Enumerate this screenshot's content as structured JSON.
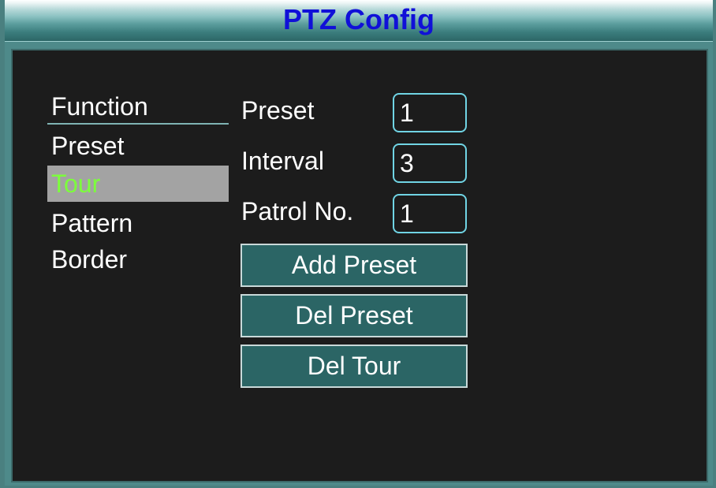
{
  "window": {
    "title": "PTZ Config"
  },
  "menu": {
    "header": "Function",
    "items": [
      {
        "label": "Preset",
        "selected": false
      },
      {
        "label": "Tour",
        "selected": true
      },
      {
        "label": "Pattern",
        "selected": false
      },
      {
        "label": "Border",
        "selected": false
      }
    ]
  },
  "fields": {
    "preset": {
      "label": "Preset",
      "value": "1"
    },
    "interval": {
      "label": "Interval",
      "value": "3"
    },
    "patrol": {
      "label": "Patrol No.",
      "value": "1"
    }
  },
  "buttons": {
    "add_preset": "Add Preset",
    "del_preset": "Del Preset",
    "del_tour": "Del Tour"
  },
  "colors": {
    "title_text": "#1010d8",
    "panel_background": "#1c1c1c",
    "frame": "#4e8a8a",
    "selected_item_background": "#a3a3a3",
    "selected_item_text": "#7cff3c",
    "field_border": "#70d4e4",
    "button_background": "#2b6565"
  }
}
